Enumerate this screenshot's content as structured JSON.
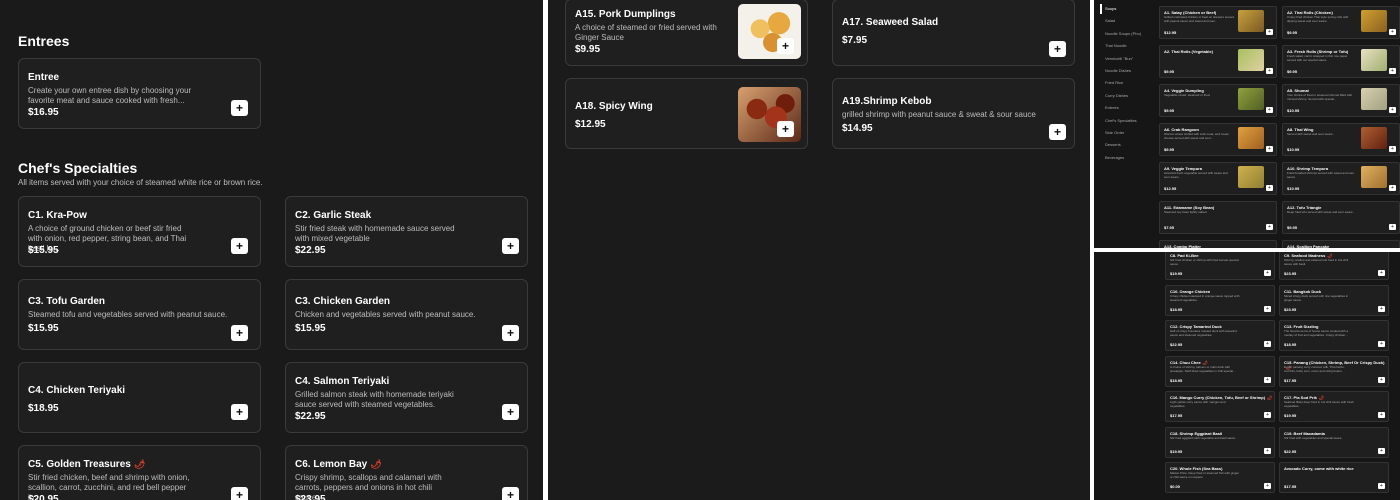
{
  "left": {
    "entrees_heading": "Entrees",
    "entree_card": {
      "title": "Entree",
      "desc": "Create your own entree dish by choosing your favorite meat and sauce cooked with fresh...",
      "price": "$16.95"
    },
    "chefs_heading": "Chef's Specialties",
    "chefs_sub": "All items served with your choice of steamed white rice or brown rice.",
    "items": [
      {
        "title": "C1. Kra-Pow",
        "desc": "A choice of ground chicken or beef stir fried with onion, red pepper, string bean, and Thai basil le...",
        "price": "$15.95",
        "spicy": false
      },
      {
        "title": "C2. Garlic Steak",
        "desc": "Stir fried steak with homemade sauce served with mixed vegetable",
        "price": "$22.95",
        "spicy": false
      },
      {
        "title": "C3. Tofu Garden",
        "desc": "Steamed tofu and vegetables served with peanut sauce.",
        "price": "$15.95",
        "spicy": false
      },
      {
        "title": "C3. Chicken Garden",
        "desc": "Chicken and vegetables served with peanut sauce.",
        "price": "$15.95",
        "spicy": false
      },
      {
        "title": "C4. Chicken Teriyaki",
        "desc": "",
        "price": "$18.95",
        "spicy": false
      },
      {
        "title": "C4. Salmon Teriyaki",
        "desc": "Grilled salmon steak with homemade teriyaki sauce served with steamed vegetables.",
        "price": "$22.95",
        "spicy": false
      },
      {
        "title": "C5. Golden Treasures",
        "desc": "Stir fried chicken, beef and shrimp with onion, scallion, carrot, zucchini, and red bell pepper in...",
        "price": "$20.95",
        "spicy": true
      },
      {
        "title": "C6. Lemon Bay",
        "desc": "Crispy shrimp, scallops and calamari with carrots, peppers and onions in hot chili sauce....",
        "price": "$23.95",
        "spicy": true
      }
    ]
  },
  "middle": {
    "items": [
      {
        "title": "A15. Pork Dumplings",
        "desc": "A choice of steamed or fried served with Ginger Sauce",
        "price": "$9.95"
      },
      {
        "title": "A17. Seaweed Salad",
        "desc": "",
        "price": "$7.95"
      },
      {
        "title": "A18. Spicy Wing",
        "desc": "",
        "price": "$12.95"
      },
      {
        "title": "A19.Shrimp Kebob",
        "desc": "grilled shrimp with peanut sauce & sweat & sour sauce",
        "price": "$14.95"
      }
    ]
  },
  "mini_top": {
    "nav": [
      "Soups",
      "Salad",
      "Noodle Soups (Pho)",
      "Thai Noodle",
      "Vermicelli \"Bun\"",
      "Noodle Dishes",
      "Fried Rice",
      "Curry Dishes",
      "Entrees",
      "Chef's Specialties",
      "Side Order",
      "Desserts",
      "Beverages"
    ],
    "cards": [
      {
        "title": "A1. Satay (Chicken or Beef)",
        "desc": "Grilled marinated chicken or beef on skewers served with peanut sauce and sweet and sour.",
        "price": "$12.95"
      },
      {
        "title": "A2. Thai Rolls (Chicken)",
        "desc": "Crispy fried chicken Thai style spring rolls with dipping sweet and sour sauce.",
        "price": "$9.95"
      },
      {
        "title": "A2. Thai Rolls (Vegetable)",
        "desc": "",
        "price": "$9.95"
      },
      {
        "title": "A3. Fresh Rolls (Shrimp or Tofu)",
        "desc": "Fresh salad, carrot wrapped in thin rice paper served with our special sauce.",
        "price": "$9.95"
      },
      {
        "title": "A4. Veggie Dumpling",
        "desc": "Vegetable mixed, steamed or fried.",
        "price": "$9.95"
      },
      {
        "title": "A5. Shumai",
        "desc": "Your choice of fried or steamed shumai filled with minced shrimp. Served with special...",
        "price": "$10.95"
      },
      {
        "title": "A6. Crab Rangoon",
        "desc": "Wonton wraps stuffed with crab meat, and cream cheese served with sweet and sour...",
        "price": "$9.95"
      },
      {
        "title": "A8. Thai Wing",
        "desc": "Served with sweet and sour sauce.",
        "price": "$10.95"
      },
      {
        "title": "A9. Veggie Tempura",
        "desc": "Assorted fresh vegetable served with sweet and sour sauce.",
        "price": "$12.95"
      },
      {
        "title": "A10. Shrimp Tempura",
        "desc": "Fried breaded shrimps served with sweet and sour sauce.",
        "price": "$10.95"
      },
      {
        "title": "A11. Edamame (Soy Bean)",
        "desc": "Steamed soy bean lightly salted.",
        "price": "$7.95"
      },
      {
        "title": "A12. Tofu Triangle",
        "desc": "Deep fried tofu served with sweet and sour sauce.",
        "price": "$9.95"
      },
      {
        "title": "A13. Combo Platter",
        "desc": "",
        "price": ""
      },
      {
        "title": "A14. Scallion Pancake",
        "desc": "",
        "price": ""
      }
    ]
  },
  "mini_bottom": {
    "cards": [
      {
        "title": "C8. Pad Ki-Bee",
        "desc": "Stir fried chicken or shrimp with fried tomato special sauce.",
        "price": "$19.95",
        "spicy": false
      },
      {
        "title": "C9. Seafood Madness",
        "desc": "Shrimp, scallop and calamari stir fried in hot chili sauce with basil.",
        "price": "$23.95",
        "spicy": true
      },
      {
        "title": "C10. Orange Chicken",
        "desc": "Crispy chicken sautéed in orange sauce topped with steamed vegetables.",
        "price": "$18.95",
        "spicy": false
      },
      {
        "title": "C11. Bangkok Duck",
        "desc": "Sliced crispy duck served with rice vegetables in ginger sauce.",
        "price": "$23.95",
        "spicy": false
      },
      {
        "title": "C12. Crispy Tamarind Duck",
        "desc": "Half of crispy boneless roasted duck with tamarind sauce and steamed vegetables.",
        "price": "$22.95",
        "spicy": false
      },
      {
        "title": "C13. Fruit Sizzling",
        "desc": "The favorite items of house sauce cooked with a medley of fruit and vegetables. Crispy chicken...",
        "price": "$18.95",
        "spicy": false
      },
      {
        "title": "C14. Chuu Chee",
        "desc": "A choice of shrimp, salmon or mahi duck with pineapple. Stuff dried vegetables in chili special...",
        "price": "$18.95",
        "spicy": true
      },
      {
        "title": "C15. Panang (Chicken, Shrimp, Beef Or Crispy Duck)",
        "desc": "Exotic panang curry coconut milk, Thai herbs, zucchini, baby corn, onion and string beans.",
        "price": "$17.95",
        "spicy": true
      },
      {
        "title": "C16. Mango Curry (Chicken, Tofu, Beef or Shrimp)",
        "desc": "Light yellow curry sauce with mangos and vegetables.",
        "price": "$17.95",
        "spicy": true
      },
      {
        "title": "C17. Pla Sod Prik",
        "desc": "Seafood fillets deep fried in hot chili sauce with fresh vegetables.",
        "price": "$19.95",
        "spicy": true
      },
      {
        "title": "C18. Shrimp Eggplant Basil",
        "desc": "Stir fried eggplant with vegetable and basil sauce.",
        "price": "$19.95",
        "spicy": false
      },
      {
        "title": "C19. Beef Macadamia",
        "desc": "Stir fried with vegetables and special sauce.",
        "price": "$22.95",
        "spicy": false
      },
      {
        "title": "C20. Whole Fish (Sea Bass)",
        "desc": "Market Price. Deep fried or steamed fish with ginger or chili sauce on request.",
        "price": "$0.00",
        "spicy": false
      },
      {
        "title": "Avocado Curry, come with white rice",
        "desc": "",
        "price": "$17.95",
        "spicy": false
      }
    ]
  },
  "colors": {
    "bg": "#1a1a1a",
    "card": "#1f1f1f",
    "border": "#3a3a3a",
    "spicy": "#e0402a"
  },
  "icons": {
    "add": "plus-icon",
    "spicy": "chili-icon"
  }
}
